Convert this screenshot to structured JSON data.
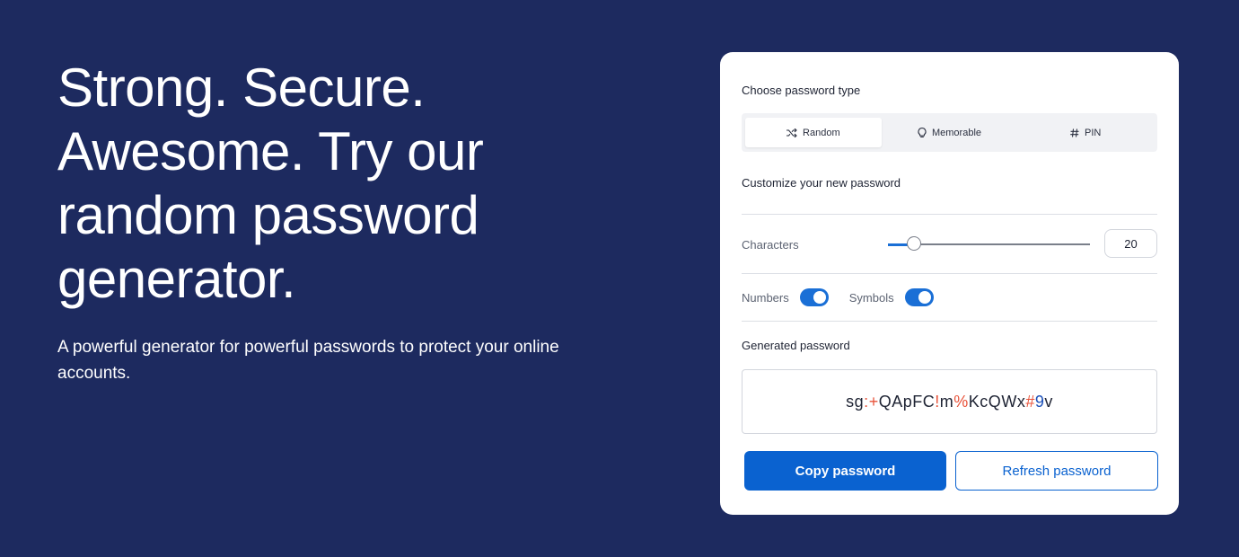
{
  "hero": {
    "title_lines": [
      "Strong. Secure.",
      "Awesome. Try our",
      "random password",
      "generator."
    ],
    "subtitle": "A powerful generator for powerful passwords to protect your online accounts."
  },
  "card": {
    "type_label": "Choose password type",
    "types": [
      {
        "label": "Random",
        "icon": "shuffle-icon",
        "active": true
      },
      {
        "label": "Memorable",
        "icon": "lightbulb-icon",
        "active": false
      },
      {
        "label": "PIN",
        "icon": "hash-icon",
        "active": false
      }
    ],
    "customize_label": "Customize your new password",
    "characters_label": "Characters",
    "characters_value": "20",
    "characters_min": 8,
    "characters_max": 100,
    "toggles": [
      {
        "label": "Numbers",
        "on": true
      },
      {
        "label": "Symbols",
        "on": true
      }
    ],
    "generated_label": "Generated password",
    "password": "sg:+QApFC!m%KcQWx#9v",
    "copy_label": "Copy password",
    "refresh_label": "Refresh password"
  },
  "colors": {
    "background": "#1d2a5f",
    "accent": "#0a62d0",
    "symbol": "#e8533a",
    "digit": "#1a4fb8"
  }
}
